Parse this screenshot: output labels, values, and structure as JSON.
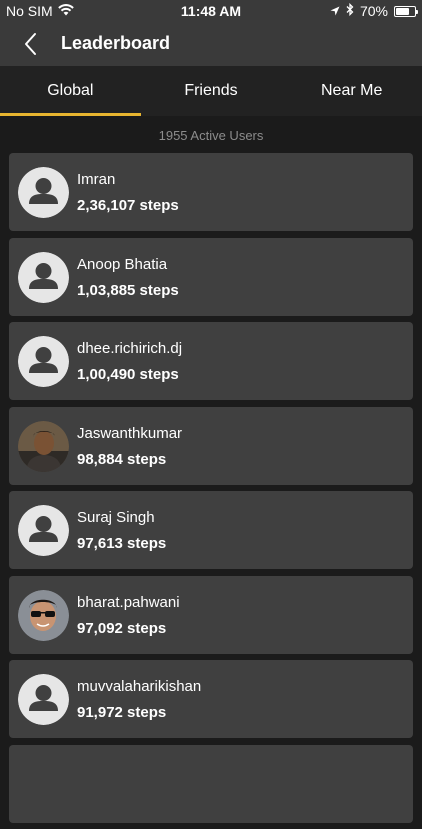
{
  "status_bar": {
    "carrier": "No SIM",
    "time": "11:48 AM",
    "battery_text": "70%",
    "battery_level": 0.7
  },
  "header": {
    "title": "Leaderboard"
  },
  "tabs": [
    {
      "label": "Global",
      "active": true
    },
    {
      "label": "Friends",
      "active": false
    },
    {
      "label": "Near Me",
      "active": false
    }
  ],
  "active_users_text": "1955 Active Users",
  "accent_color": "#e8b530",
  "users": [
    {
      "name": "Imran",
      "steps": "2,36,107 steps",
      "avatar": "default-avatar-icon"
    },
    {
      "name": "Anoop Bhatia",
      "steps": "1,03,885 steps",
      "avatar": "default-avatar-icon"
    },
    {
      "name": "dhee.richirich.dj",
      "steps": "1,00,490 steps",
      "avatar": "default-avatar-icon"
    },
    {
      "name": "Jaswanthkumar",
      "steps": "98,884 steps",
      "avatar": "photo"
    },
    {
      "name": "Suraj Singh",
      "steps": "97,613 steps",
      "avatar": "default-avatar-icon"
    },
    {
      "name": "bharat.pahwani",
      "steps": "97,092 steps",
      "avatar": "photo"
    },
    {
      "name": "muvvalaharikishan",
      "steps": "91,972 steps",
      "avatar": "default-avatar-icon"
    }
  ]
}
